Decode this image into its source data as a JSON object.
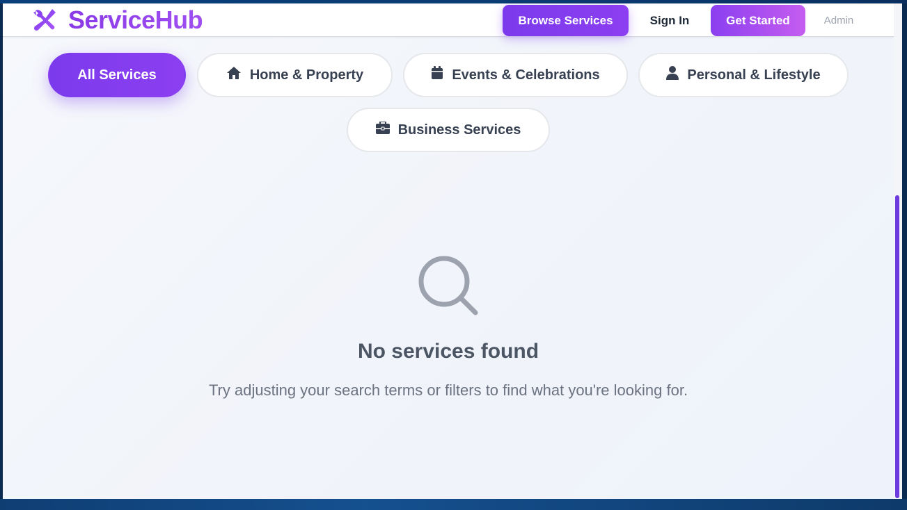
{
  "header": {
    "brand": "ServiceHub",
    "nav": {
      "browse_label": "Browse Services",
      "signin_label": "Sign In",
      "getstarted_label": "Get Started",
      "admin_label": "Admin"
    }
  },
  "filters": {
    "active": "All Services",
    "items": [
      {
        "label": "All Services",
        "icon": "none"
      },
      {
        "label": "Home & Property",
        "icon": "home-icon"
      },
      {
        "label": "Events & Celebrations",
        "icon": "calendar-icon"
      },
      {
        "label": "Personal & Lifestyle",
        "icon": "user-icon"
      },
      {
        "label": "Business Services",
        "icon": "briefcase-icon"
      }
    ]
  },
  "empty_state": {
    "icon": "search-icon",
    "title": "No services found",
    "message": "Try adjusting your search terms or filters to find what you're looking for."
  },
  "colors": {
    "accent": "#7c3aed",
    "accent_gradient_end": "#c55df0",
    "text_primary": "#374151",
    "text_muted": "#6b7280"
  }
}
